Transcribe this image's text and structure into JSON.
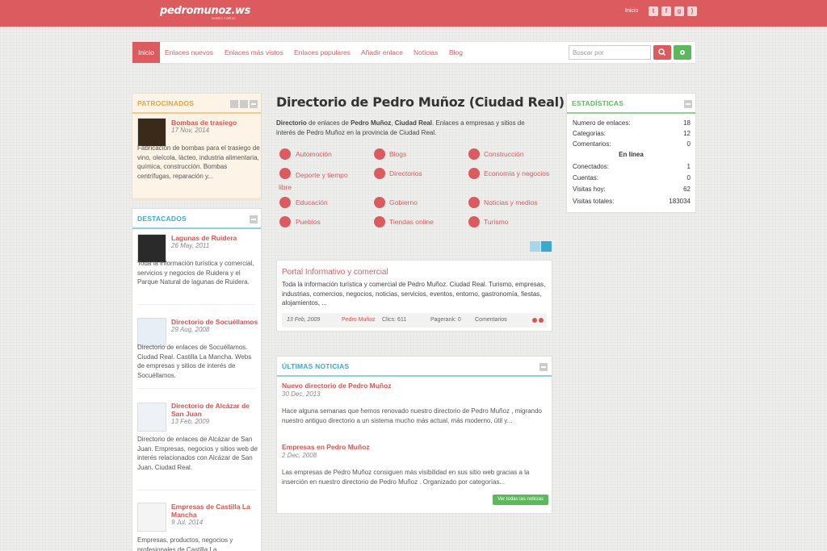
{
  "header": {
    "logo": "pedromunoz.ws",
    "logo_sub": "DIRECTORIO",
    "top_link": "Inicio",
    "social_icons": [
      "twitter-icon",
      "facebook-icon",
      "google-plus-icon",
      "rss-icon"
    ]
  },
  "nav": {
    "items": [
      "Inicio",
      "Enlaces nuevos",
      "Enlaces más vistos",
      "Enlaces populares",
      "Añadir enlace",
      "Noticias",
      "Blog"
    ],
    "search_placeholder": "Buscar por"
  },
  "patrocinados": {
    "title": "PATROCINADOS",
    "item": {
      "title": "Bombas de trasiego",
      "date": "17 Nov, 2014",
      "desc": "Fabricación de bombas para el trasiego de vino, oleícola, lácteo, industria alimentaria, química, construcción. Bombas centrífugas, reparación y..."
    }
  },
  "destacados": {
    "title": "DESTACADOS",
    "items": [
      {
        "title": "Lagunas de Ruidera",
        "date": "26 May, 2011",
        "desc": "Toda la información turística y comercial, servicios y negocios de Ruidera y el Parque Natural de lagunas de Ruidera."
      },
      {
        "title": "Directorio de Socuéllamos",
        "date": "29 Aug, 2008",
        "desc": "Directorio de enlaces de Socuéllamos. Ciudad Real. Castilla La Mancha. Webs de empresas y sitios de interés de Socuéllamos."
      },
      {
        "title": "Directorio de Alcázar de San Juan",
        "date": "13 Feb, 2009",
        "desc": "Directorio de enlaces de Alcázar de San Juan. Empresas, negocios y sitios web de interés relacionados con Alcázar de San Juan. Ciudad Real."
      },
      {
        "title": "Empresas de Castilla La Mancha",
        "date": "9 Jul, 2014",
        "desc": "Empresas, productos, negocios y profesionales de Castilla La"
      }
    ]
  },
  "main": {
    "title": "Directorio de Pedro Muñoz (Ciudad Real)",
    "intro_bold1": "Directorio",
    "intro_text1": " de enlaces de ",
    "intro_bold2": "Pedro Muñoz",
    "intro_text2": ", ",
    "intro_bold3": "Ciudad Real",
    "intro_text3": ". Enlaces a empresas y sitios de interés de Pedro Muñoz en la provincia de Ciudad Real.",
    "categories": [
      "Automoción",
      "Blogs",
      "Construcción",
      "Deporte y tiempo libre",
      "Directorios",
      "Economía y negocios",
      "Educación",
      "Gobierno",
      "Noticias y medios",
      "Pueblos",
      "Tiendas online",
      "Turismo"
    ],
    "category_icons": [
      "car-icon",
      "globe-icon",
      "crane-icon",
      "football-icon",
      "globe-icon",
      "gears-icon",
      "graduation-cap-icon",
      "bank-icon",
      "microphone-icon",
      "map-pin-icon",
      "shopping-basket-icon",
      "compass-icon"
    ]
  },
  "listing": {
    "title": "Portal Informativo y comercial",
    "desc": "Toda la información turística y comercial de Pedro Muñoz. Ciudad Real. Turismo, empresas, industrias, comercios, negocios, noticias, servicios, eventos, entorno, gastronomía, fiestas, alojamientos, ...",
    "date": "13 Feb, 2009",
    "category": "Pedro Muñoz",
    "clicks": "Clics: 611",
    "pagerank": "Pagerank: 0",
    "comments": "Comentarios"
  },
  "noticias": {
    "title": "ÚLTIMAS NOTICIAS",
    "items": [
      {
        "title": "Nuevo directorio de Pedro Muñoz",
        "date": "30 Dec, 2013",
        "desc": "Hace alguna semanas que hemos renovado nuestro directorio de Pedro Muñoz , migrando nuestro antiguo directorio a un sistema mucho más actual, más moderno, útil y..."
      },
      {
        "title": "Empresas en Pedro Muñoz",
        "date": "2 Dec, 2008",
        "desc": "Las empresas de Pedro Muñoz consiguen más visibilidad en sus sitio web gracias a la inserción en nuestro directorio de Pedro Muñoz . Organizado por categorías..."
      }
    ],
    "button": "Ver todas las noticias"
  },
  "stats": {
    "title": "ESTADÍSTICAS",
    "rows": [
      {
        "label": "Numero de enlaces:",
        "value": "18"
      },
      {
        "label": "Categorias:",
        "value": "12"
      },
      {
        "label": "Comentarios:",
        "value": "0"
      }
    ],
    "online_title": "En línea",
    "online_rows": [
      {
        "label": "Conectados:",
        "value": "1"
      },
      {
        "label": "Cuentas:",
        "value": "0"
      },
      {
        "label": "Visitas hoy:",
        "value": "62"
      },
      {
        "label": "Visitas totales:",
        "value": "183034"
      }
    ]
  },
  "colors": {
    "brand": "#dc5b5f",
    "accent_blue": "#3aa9cf",
    "accent_orange": "#e8a53a",
    "accent_green": "#5cb85c"
  }
}
